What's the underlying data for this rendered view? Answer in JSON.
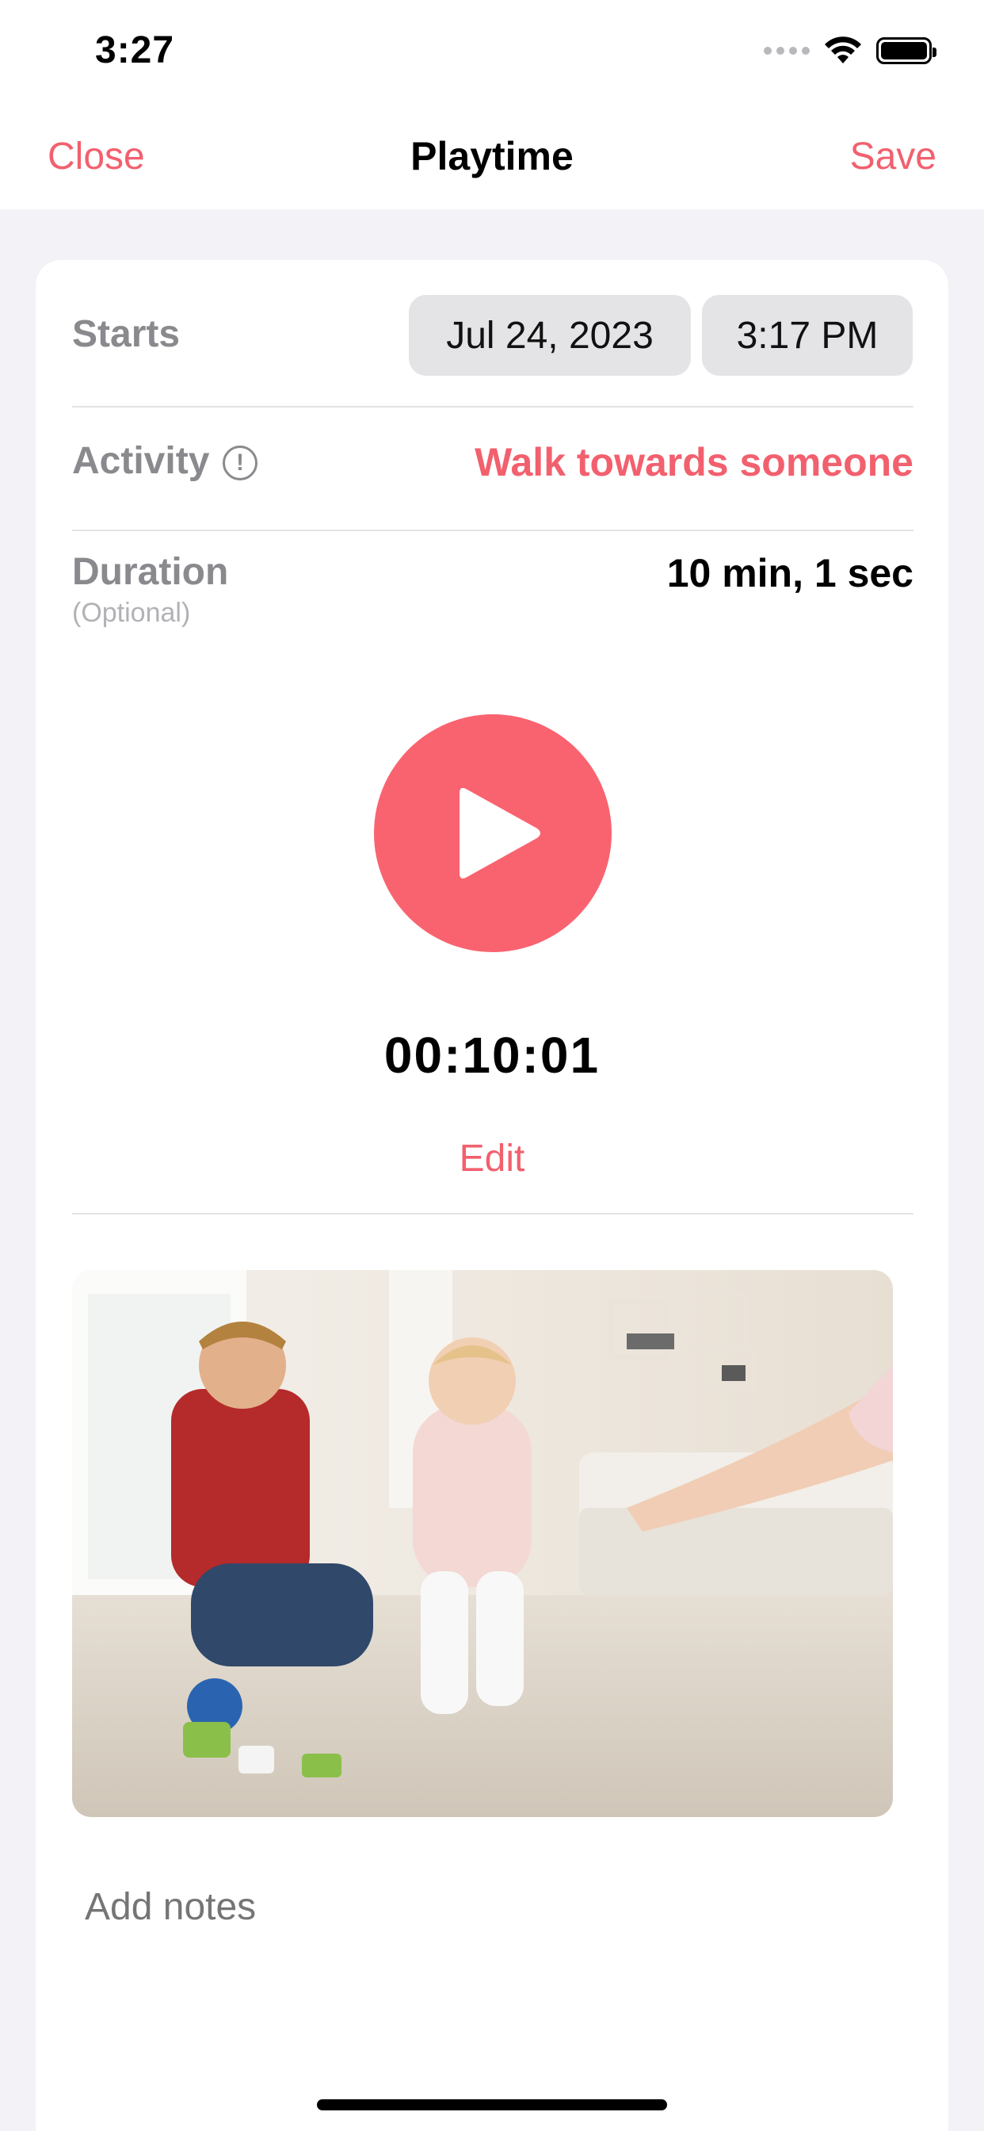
{
  "status_bar": {
    "time": "3:27"
  },
  "nav": {
    "close_label": "Close",
    "title": "Playtime",
    "save_label": "Save"
  },
  "form": {
    "starts_label": "Starts",
    "start_date": "Jul 24, 2023",
    "start_time": "3:17 PM",
    "activity_label": "Activity",
    "activity_value": "Walk towards someone",
    "duration_label": "Duration",
    "duration_optional": "(Optional)",
    "duration_value": "10 min, 1 sec"
  },
  "timer": {
    "display": "00:10:01",
    "edit_label": "Edit"
  },
  "notes": {
    "placeholder": "Add notes"
  },
  "colors": {
    "accent": "#f2606e",
    "play_button": "#f9636f",
    "background": "#f2f2f7"
  },
  "icons": [
    "wifi-icon",
    "battery-icon",
    "info-icon",
    "play-icon"
  ]
}
